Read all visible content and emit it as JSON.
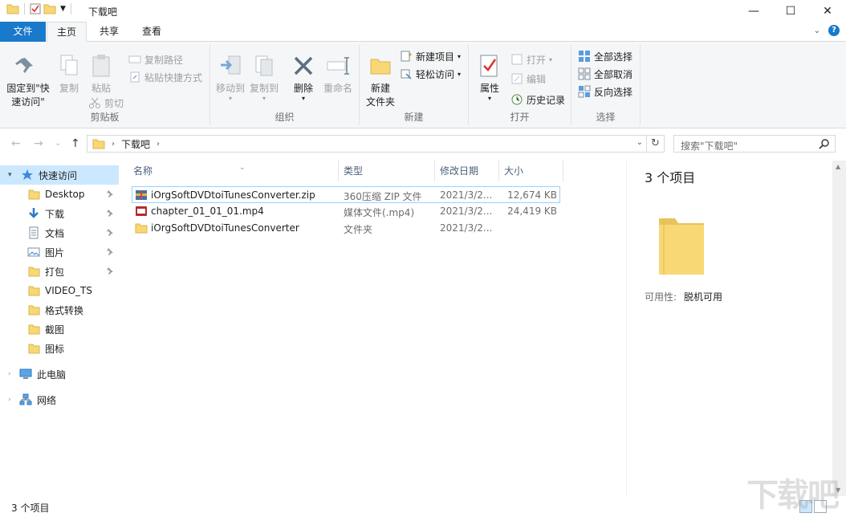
{
  "window": {
    "title": "下载吧",
    "controls": {
      "minimize": "—",
      "maximize": "☐",
      "close": "✕"
    }
  },
  "tabs": [
    {
      "label": "文件"
    },
    {
      "label": "主页"
    },
    {
      "label": "共享"
    },
    {
      "label": "查看"
    }
  ],
  "ribbon": {
    "clipboard": {
      "label": "剪贴板",
      "pin_quick_access": "固定到\"快\n速访问\"",
      "copy": "复制",
      "paste": "粘贴",
      "copy_path": "复制路径",
      "paste_shortcut": "粘贴快捷方式",
      "cut": "剪切"
    },
    "organize": {
      "label": "组织",
      "move_to": "移动到",
      "copy_to": "复制到",
      "delete": "删除",
      "rename": "重命名"
    },
    "new": {
      "label": "新建",
      "new_folder": "新建\n文件夹",
      "new_item": "新建项目",
      "easy_access": "轻松访问"
    },
    "open": {
      "label": "打开",
      "properties": "属性",
      "open": "打开",
      "edit": "编辑",
      "history": "历史记录"
    },
    "select": {
      "label": "选择",
      "select_all": "全部选择",
      "select_none": "全部取消",
      "invert": "反向选择"
    }
  },
  "address": {
    "crumb": "下载吧",
    "search_placeholder": "搜索\"下载吧\""
  },
  "nav": [
    {
      "label": "快速访问",
      "icon": "star-icon",
      "selected": true
    },
    {
      "label": "Desktop",
      "icon": "folder-icon",
      "pinned": true
    },
    {
      "label": "下载",
      "icon": "download-icon",
      "pinned": true
    },
    {
      "label": "文档",
      "icon": "document-icon",
      "pinned": true
    },
    {
      "label": "图片",
      "icon": "picture-icon",
      "pinned": true
    },
    {
      "label": "打包",
      "icon": "folder-icon",
      "pinned": true
    },
    {
      "label": "VIDEO_TS",
      "icon": "folder-icon"
    },
    {
      "label": "格式转换",
      "icon": "folder-icon"
    },
    {
      "label": "截图",
      "icon": "folder-icon"
    },
    {
      "label": "图标",
      "icon": "folder-icon"
    },
    {
      "label": "此电脑",
      "icon": "computer-icon"
    },
    {
      "label": "网络",
      "icon": "network-icon"
    }
  ],
  "columns": {
    "name": "名称",
    "type": "类型",
    "date": "修改日期",
    "size": "大小"
  },
  "files": [
    {
      "name": "iOrgSoftDVDtoiTunesConverter.zip",
      "type": "360压缩 ZIP 文件",
      "date": "2021/3/2...",
      "size": "12,674 KB",
      "icon": "zip-icon"
    },
    {
      "name": "chapter_01_01_01.mp4",
      "type": "媒体文件(.mp4)",
      "date": "2021/3/2...",
      "size": "24,419 KB",
      "icon": "mp4-icon"
    },
    {
      "name": "iOrgSoftDVDtoiTunesConverter",
      "type": "文件夹",
      "date": "2021/3/2...",
      "size": "",
      "icon": "folder-icon"
    }
  ],
  "details": {
    "count": "3 个项目",
    "availability_label": "可用性:",
    "availability_value": "脱机可用"
  },
  "status": {
    "text": "3 个项目"
  },
  "watermark": "下载吧",
  "colors": {
    "accent": "#1979ca",
    "selection": "#cce8ff",
    "folder": "#f8d775"
  }
}
